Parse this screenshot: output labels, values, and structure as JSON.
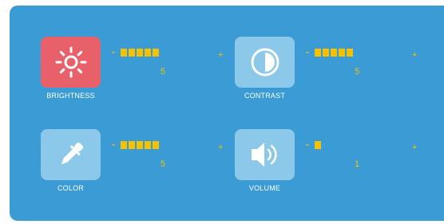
{
  "colors": {
    "panel": "#3a9bd5",
    "tile": "#8cc8e9",
    "tile_active": "#e8606a",
    "accent": "#f6c100"
  },
  "controls": [
    {
      "key": "brightness",
      "label": "BRIGHTNESS",
      "icon": "sun-icon",
      "level": 5,
      "max": 5,
      "value_text": "5",
      "minus": "-",
      "plus": "+",
      "active": true
    },
    {
      "key": "contrast",
      "label": "CONTRAST",
      "icon": "contrast-icon",
      "level": 5,
      "max": 5,
      "value_text": "5",
      "minus": "-",
      "plus": "+",
      "active": false
    },
    {
      "key": "color",
      "label": "COLOR",
      "icon": "eyedropper-icon",
      "level": 5,
      "max": 5,
      "value_text": "5",
      "minus": "-",
      "plus": "+",
      "active": false
    },
    {
      "key": "volume",
      "label": "VOLUME",
      "icon": "speaker-icon",
      "level": 1,
      "max": 5,
      "value_text": "1",
      "minus": "-",
      "plus": "+",
      "active": false
    }
  ]
}
